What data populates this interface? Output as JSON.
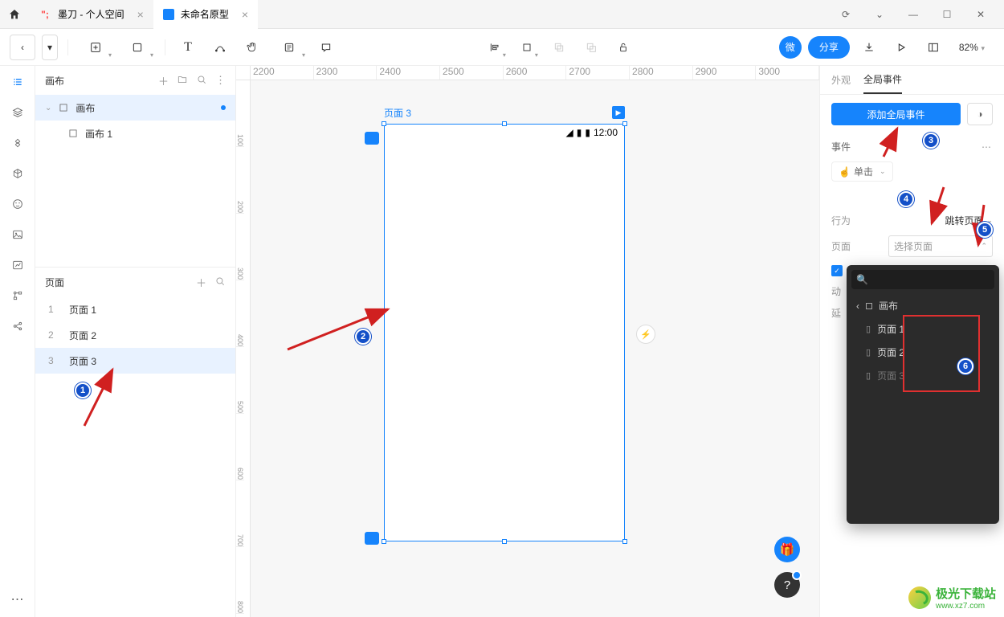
{
  "tabs": [
    {
      "title": "墨刀 - 个人空间"
    },
    {
      "title": "未命名原型"
    }
  ],
  "zoom": "82%",
  "toolbar": {
    "wei": "微",
    "share": "分享"
  },
  "leftpanel": {
    "canvas_header": "画布",
    "tree_root": "画布",
    "tree_child": "画布 1",
    "pages_header": "页面",
    "pages": [
      {
        "num": "1",
        "name": "页面 1"
      },
      {
        "num": "2",
        "name": "页面 2"
      },
      {
        "num": "3",
        "name": "页面 3"
      }
    ]
  },
  "artboard": {
    "label": "页面 3",
    "time": "12:00"
  },
  "rightpanel": {
    "tab1": "外观",
    "tab2": "全局事件",
    "add_event": "添加全局事件",
    "event_header": "事件",
    "click": "单击",
    "action_lbl": "行为",
    "action_val": "跳转页面",
    "page_lbl": "页面",
    "page_placeholder": "选择页面",
    "dyn_lbl": "动",
    "delay_lbl": "延"
  },
  "dropdown": {
    "crumb": "画布",
    "options": [
      {
        "name": "页面 1",
        "dim": false
      },
      {
        "name": "页面 2",
        "dim": false
      },
      {
        "name": "页面 3",
        "dim": true
      }
    ]
  },
  "ruler_h": [
    "2200",
    "2300",
    "2400",
    "2500",
    "2600",
    "2700",
    "2800",
    "2900",
    "3000"
  ],
  "ruler_v": [
    "100",
    "200",
    "300",
    "400",
    "500",
    "600",
    "700",
    "800"
  ],
  "watermark": {
    "name": "极光下载站",
    "url": "www.xz7.com"
  }
}
